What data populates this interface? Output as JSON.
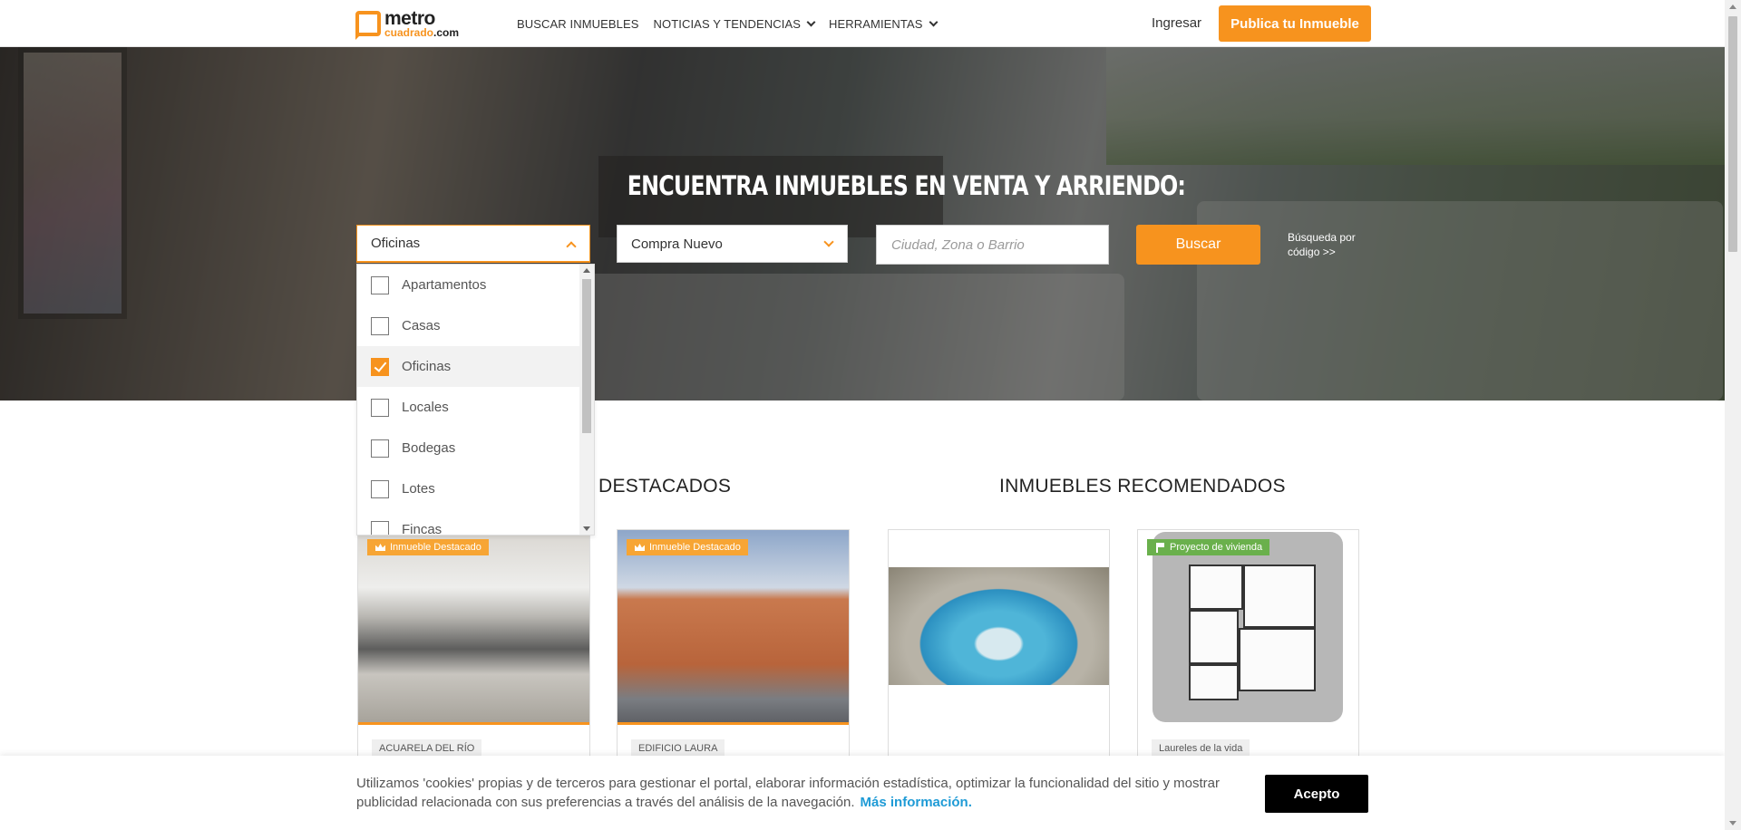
{
  "header": {
    "logo_main": "metro",
    "logo_sub": "cuadrado",
    "logo_dotcom": ".com",
    "nav": [
      {
        "label": "BUSCAR INMUEBLES",
        "dropdown": false
      },
      {
        "label": "NOTICIAS Y TENDENCIAS",
        "dropdown": true
      },
      {
        "label": "HERRAMIENTAS",
        "dropdown": true
      }
    ],
    "login_label": "Ingresar",
    "publish_label": "Publica tu Inmueble"
  },
  "hero": {
    "title": "ENCUENTRA INMUEBLES EN VENTA Y ARRIENDO:",
    "property_type_value": "Oficinas",
    "operation_value": "Compra Nuevo",
    "city_placeholder": "Ciudad, Zona o Barrio",
    "search_label": "Buscar",
    "by_code_line1": "Búsqueda por",
    "by_code_line2": "código  >>"
  },
  "property_type_options": [
    {
      "label": "Apartamentos",
      "checked": false
    },
    {
      "label": "Casas",
      "checked": false
    },
    {
      "label": "Oficinas",
      "checked": true
    },
    {
      "label": "Locales",
      "checked": false
    },
    {
      "label": "Bodegas",
      "checked": false
    },
    {
      "label": "Lotes",
      "checked": false
    },
    {
      "label": "Fincas",
      "checked": false
    }
  ],
  "sections": {
    "featured_title": "DESTACADOS",
    "recommended_title": "INMUEBLES RECOMENDADOS"
  },
  "cards": [
    {
      "badge": "Inmueble Destacado",
      "label": "ACUARELA DEL RÍO"
    },
    {
      "badge": "Inmueble Destacado",
      "label": "EDIFICIO LAURA"
    },
    {
      "badge": "",
      "label": ""
    },
    {
      "badge": "Proyecto de vivienda",
      "label": "Laureles de la vida"
    }
  ],
  "cookie": {
    "text": "Utilizamos 'cookies' propias y de terceros para gestionar el portal, elaborar información estadística, optimizar la funcionalidad del sitio y mostrar publicidad relacionada con sus preferencias a través del análisis de la navegación.",
    "link_label": "Más información.",
    "accept_label": "Acepto"
  },
  "colors": {
    "brand_orange": "#f7931e",
    "featured_badge": "#f7a534",
    "project_badge": "#6ab04c",
    "link_blue": "#1f9bd6"
  }
}
